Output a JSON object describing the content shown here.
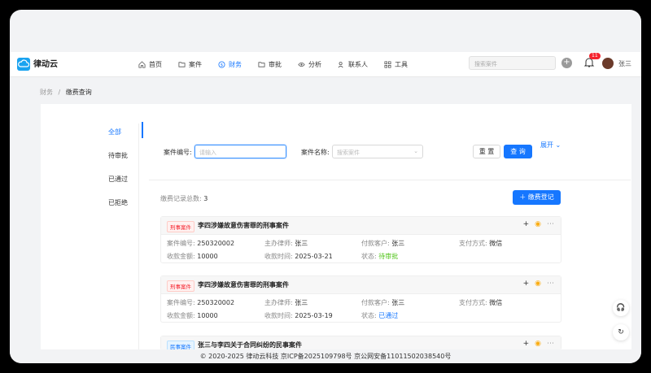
{
  "app": {
    "name": "律动云"
  },
  "nav": [
    {
      "label": "首页",
      "icon": "home-icon"
    },
    {
      "label": "案件",
      "icon": "folder-icon"
    },
    {
      "label": "财务",
      "icon": "money-icon",
      "active": true
    },
    {
      "label": "审批",
      "icon": "folder-icon"
    },
    {
      "label": "分析",
      "icon": "eye-icon"
    },
    {
      "label": "联系人",
      "icon": "contacts-icon"
    },
    {
      "label": "工具",
      "icon": "tools-icon"
    }
  ],
  "header": {
    "search_placeholder": "搜索案件",
    "notifications": "11",
    "user": "张三"
  },
  "breadcrumb": {
    "parent": "财务",
    "sep": "/",
    "current": "缴费查询"
  },
  "side": [
    "全部",
    "待审批",
    "已通过",
    "已拒绝"
  ],
  "filter": {
    "case_no_label": "案件编号:",
    "case_no_placeholder": "请输入",
    "case_name_label": "案件名称:",
    "case_name_placeholder": "搜索案件",
    "reset": "重 置",
    "query": "查 询",
    "expand": "展开"
  },
  "summary": {
    "label": "缴费记录总数:",
    "count": "3",
    "register": "缴费登记"
  },
  "records": [
    {
      "tag": "刑事案件",
      "title": "李四涉嫌故意伤害罪的刑事案件",
      "case_no_label": "案件编号:",
      "case_no": "250320002",
      "lawyer_label": "主办律师:",
      "lawyer": "张三",
      "customer_label": "付款客户:",
      "customer": "张三",
      "pay_label": "支付方式:",
      "pay": "微信",
      "amount_label": "收款金额:",
      "amount": "10000",
      "time_label": "收款时间:",
      "time": "2025-03-21",
      "status_label": "状态:",
      "status": "待审批"
    },
    {
      "tag": "刑事案件",
      "title": "李四涉嫌故意伤害罪的刑事案件",
      "case_no_label": "案件编号:",
      "case_no": "250320002",
      "lawyer_label": "主办律师:",
      "lawyer": "张三",
      "customer_label": "付款客户:",
      "customer": "张三",
      "pay_label": "支付方式:",
      "pay": "微信",
      "amount_label": "收款金额:",
      "amount": "10000",
      "time_label": "收款时间:",
      "time": "2025-03-19",
      "status_label": "状态:",
      "status": "已通过"
    },
    {
      "tag": "民事案件",
      "title": "张三与李四关于合同纠纷的民事案件"
    }
  ],
  "footer": "© 2020-2025 律动云科技 京ICP备2025109798号 京公网安备11011502038540号",
  "colors": {
    "primary": "#1677ff",
    "pending": "#52c41a",
    "danger": "#f5222d"
  }
}
